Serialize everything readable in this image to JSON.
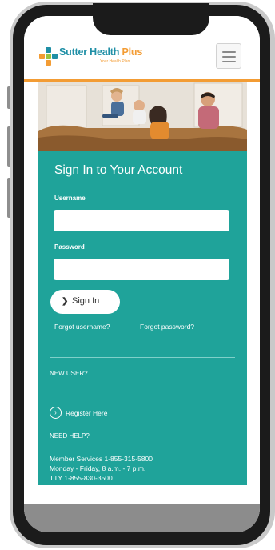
{
  "header": {
    "logo_brand": "Sutter Health",
    "logo_plus": "Plus",
    "logo_tagline": "Your Health Plan",
    "menu_icon": "hamburger-menu-icon"
  },
  "hero": {
    "image": "family-on-couch-photo"
  },
  "signin": {
    "title": "Sign In to Your Account",
    "username_label": "Username",
    "username_value": "",
    "password_label": "Password",
    "password_value": "",
    "button_label": "Sign In",
    "forgot_username": "Forgot username?",
    "forgot_password": "Forgot password?"
  },
  "new_user": {
    "heading": "NEW USER?",
    "register_label": "Register Here",
    "register_icon": "chevron-right-circle-icon"
  },
  "help": {
    "heading": "NEED HELP?",
    "member_services": "Member Services 1-855-315-5800",
    "hours": "Monday - Friday, 8 a.m. - 7 p.m.",
    "tty": "TTY 1-855-830-3500"
  },
  "colors": {
    "teal_panel": "#1fa39a",
    "brand_blue": "#1f8fa6",
    "accent_orange": "#f39c34"
  }
}
